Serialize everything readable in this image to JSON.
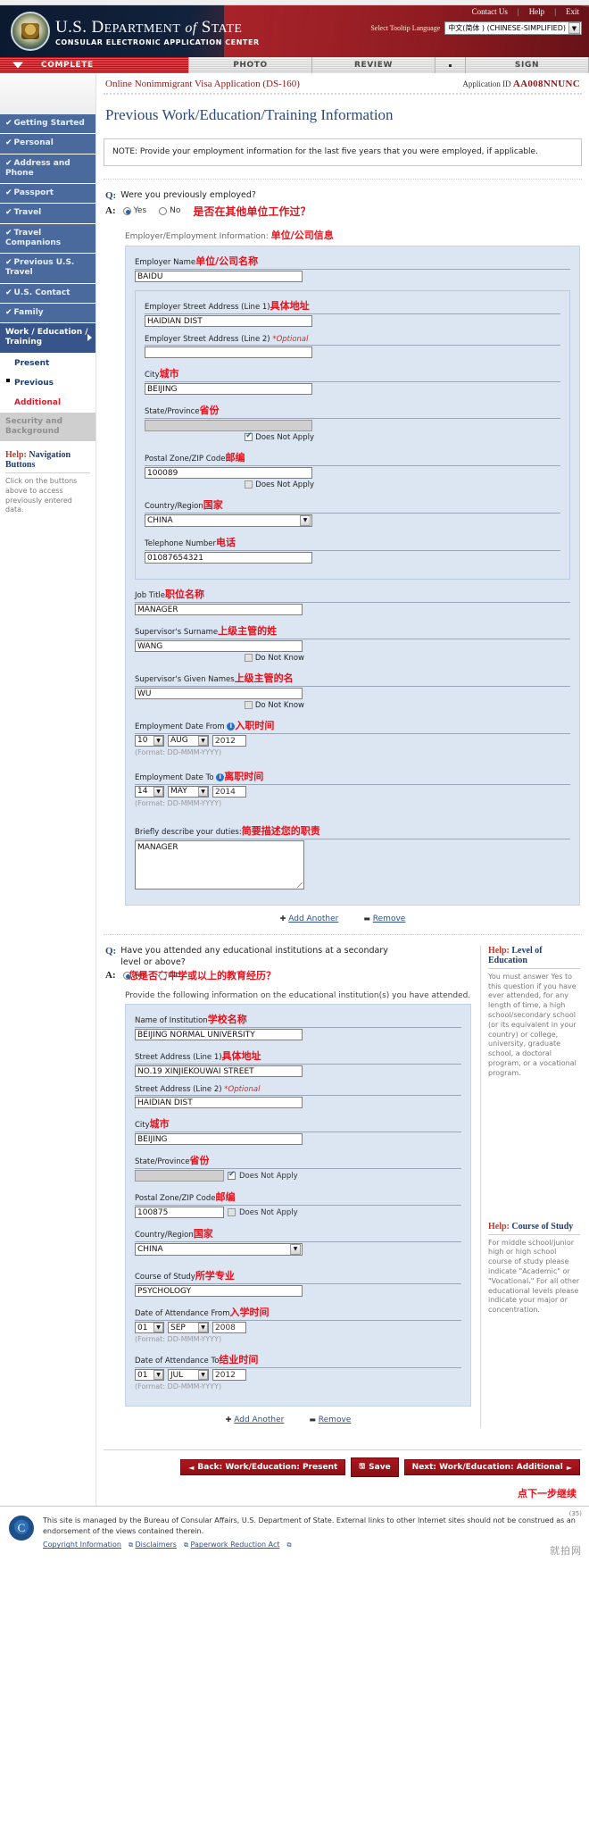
{
  "header": {
    "top_links": [
      "Contact Us",
      "Help",
      "Exit"
    ],
    "agency_line1_prefix": "U.S. D",
    "agency_line1": "U.S. DEPARTMENT of STATE",
    "agency_line2": "CONSULAR ELECTRONIC APPLICATION CENTER",
    "tooltip_language_label": "Select Tooltip Language",
    "tooltip_language_value": "中文(简体 ) (CHINESE-SIMPLIFIED)"
  },
  "steps": [
    {
      "label": "COMPLETE",
      "active": true
    },
    {
      "label": "PHOTO",
      "active": false
    },
    {
      "label": "REVIEW",
      "active": false
    },
    {
      "label": "",
      "active": false
    },
    {
      "label": "SIGN",
      "active": false
    }
  ],
  "appbar": {
    "title": "Online Nonimmigrant Visa Application (DS-160)",
    "application_id_label": "Application ID",
    "application_id": "AA008NNUNC"
  },
  "page_title": "Previous Work/Education/Training Information",
  "note": "NOTE: Provide your employment information for the last five years that you were employed, if applicable.",
  "sidebar": {
    "items": [
      {
        "label": "Getting Started",
        "check": "✔"
      },
      {
        "label": "Personal",
        "check": "✔"
      },
      {
        "label": "Address and Phone",
        "check": "✔"
      },
      {
        "label": "Passport",
        "check": "✔"
      },
      {
        "label": "Travel",
        "check": "✔"
      },
      {
        "label": "Travel Companions",
        "check": "✔"
      },
      {
        "label": "Previous U.S. Travel",
        "check": "✔"
      },
      {
        "label": "U.S. Contact",
        "check": "✔"
      },
      {
        "label": "Family",
        "check": "✔"
      }
    ],
    "current_item": "Work / Education / Training",
    "sub_items": [
      {
        "label": "Present",
        "state": "normal"
      },
      {
        "label": "Previous",
        "state": "current"
      },
      {
        "label": "Additional",
        "state": "red"
      }
    ],
    "disabled_item": "Security and Background",
    "help_title_prefix": "Help:",
    "help_title": "Navigation Buttons",
    "help_text": "Click on the buttons above to access previously entered data."
  },
  "work": {
    "question": "Were you previously employed?",
    "question_cn": "是否在其他单位工作过？",
    "q_mark": "Q:",
    "a_mark": "A:",
    "yes": "Yes",
    "no": "No",
    "answer": "Yes",
    "employer_info_label": "Employer/Employment Information:",
    "employer_info_cn": "单位/公司信息",
    "fields": {
      "employer_name_label": "Employer Name",
      "employer_name_cn": "单位/公司名称",
      "employer_name_value": "BAIDU",
      "street1_label": "Employer Street Address (Line 1)",
      "street1_cn": "具体地址",
      "street1_value": "HAIDIAN DIST",
      "street2_label": "Employer Street Address (Line 2)",
      "street2_optional": "*Optional",
      "street2_value": "",
      "city_label": "City",
      "city_cn": "城市",
      "city_value": "BEIJING",
      "state_label": "State/Province",
      "state_cn": "省份",
      "state_value": "",
      "state_does_not_apply": "Does Not Apply",
      "state_does_not_apply_checked": true,
      "postal_label": "Postal Zone/ZIP Code",
      "postal_cn": "邮编",
      "postal_value": "100089",
      "postal_does_not_apply": "Does Not Apply",
      "postal_does_not_apply_checked": false,
      "country_label": "Country/Region",
      "country_cn": "国家",
      "country_value": "CHINA",
      "phone_label": "Telephone Number",
      "phone_cn": "电话",
      "phone_value": "01087654321",
      "job_title_label": "Job Title",
      "job_title_cn": "职位名称",
      "job_title_value": "MANAGER",
      "sup_surname_label": "Supervisor's Surname",
      "sup_surname_cn": "上级主管的姓",
      "sup_surname_value": "WANG",
      "sup_surname_dnk": "Do Not Know",
      "sup_given_label": "Supervisor's Given Names",
      "sup_given_cn": "上级主管的名",
      "sup_given_value": "WU",
      "sup_given_dnk": "Do Not Know",
      "date_from_label": "Employment Date From",
      "date_from_cn": "入职时间",
      "date_from_day": "10",
      "date_from_month": "AUG",
      "date_from_year": "2012",
      "date_to_label": "Employment Date To",
      "date_to_cn": "离职时间",
      "date_to_day": "14",
      "date_to_month": "MAY",
      "date_to_year": "2014",
      "date_format": "(Format: DD-MMM-YYYY)",
      "duties_label": "Briefly describe your duties:",
      "duties_cn": "简要描述您的职责",
      "duties_value": "MANAGER"
    },
    "add_another": "Add Another",
    "remove": "Remove"
  },
  "education": {
    "question": "Have you attended any educational institutions at a secondary level or above?",
    "question_cn": "您是否有中学或以上的教育经历？",
    "q_mark": "Q:",
    "a_mark": "A:",
    "yes": "Yes",
    "no": "No",
    "answer": "Yes",
    "instruction": "Provide the following information on the educational institution(s) you have attended.",
    "fields": {
      "institution_label": "Name of Institution",
      "institution_cn": "学校名称",
      "institution_value": "BEIJING NORMAL UNIVERSITY",
      "street1_label": "Street Address (Line 1)",
      "street1_cn": "具体地址",
      "street1_value": "NO.19 XINJIEKOUWAI STREET",
      "street2_label": "Street Address (Line 2)",
      "street2_optional": "*Optional",
      "street2_value": "HAIDIAN DIST",
      "city_label": "City",
      "city_cn": "城市",
      "city_value": "BEIJING",
      "state_label": "State/Province",
      "state_cn": "省份",
      "state_value": "",
      "state_does_not_apply": "Does Not Apply",
      "state_does_not_apply_checked": true,
      "postal_label": "Postal Zone/ZIP Code",
      "postal_cn": "邮编",
      "postal_value": "100875",
      "postal_does_not_apply": "Does Not Apply",
      "postal_does_not_apply_checked": false,
      "country_label": "Country/Region",
      "country_cn": "国家",
      "country_value": "CHINA",
      "course_label": "Course of Study",
      "course_cn": "所学专业",
      "course_value": "PSYCHOLOGY",
      "att_from_label": "Date of Attendance From",
      "att_from_cn": "入学时间",
      "att_from_day": "01",
      "att_from_month": "SEP",
      "att_from_year": "2008",
      "att_to_label": "Date of Attendance To",
      "att_to_cn": "结业时间",
      "att_to_day": "01",
      "att_to_month": "JUL",
      "att_to_year": "2012",
      "date_format": "(Format: DD-MMM-YYYY)"
    },
    "add_another": "Add Another",
    "remove": "Remove",
    "help_level_title_prefix": "Help:",
    "help_level_title": "Level of Education",
    "help_level_text": "You must answer Yes to this question if you have ever attended, for any length of time, a high school/secondary school (or its equivalent in your country) or college, university, graduate school, a doctoral program, or a vocational program.",
    "help_course_title_prefix": "Help:",
    "help_course_title": "Course of Study",
    "help_course_text": "For middle school/junior high or high school course of study please indicate \"Academic\" or \"Vocational.\" For all other educational levels please indicate your major or concentration."
  },
  "buttons": {
    "back": "Back: Work/Education: Present",
    "back_icon": "◄",
    "save": "Save",
    "save_icon": "💾",
    "next": "Next: Work/Education: Additional",
    "next_icon": "►",
    "next_hint_cn": "点下一步继续"
  },
  "footer": {
    "seal_letter": "C",
    "text": "This site is managed by the Bureau of Consular Affairs, U.S. Department of State. External links to other Internet sites should not be construed as an endorsement of the views contained therein.",
    "links": [
      "Copyright Information",
      "Disclaimers",
      "Paperwork Reduction Act"
    ],
    "watermark": "就拍网",
    "corner_number": "(35)"
  }
}
